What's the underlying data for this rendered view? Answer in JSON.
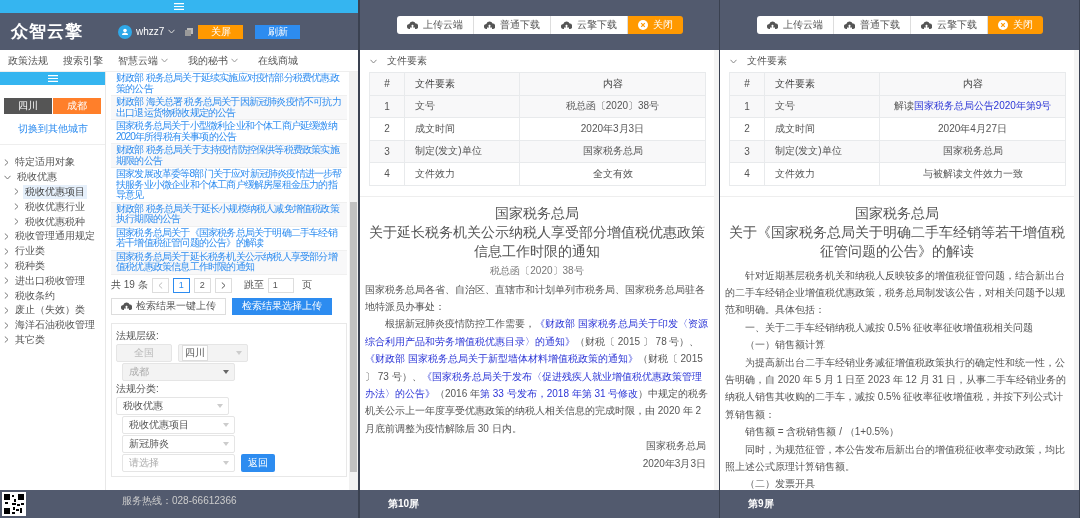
{
  "left": {
    "logo": "众智云擎",
    "user": {
      "name": "whzz7"
    },
    "header_buttons": [
      {
        "label": "关屏",
        "kind": "warning"
      },
      {
        "label": "刷新",
        "kind": "primary"
      }
    ],
    "nav": [
      {
        "label": "政策法规",
        "has_menu": false
      },
      {
        "label": "搜索引擎",
        "has_menu": false
      },
      {
        "label": "智慧云端",
        "has_menu": true
      },
      {
        "label": "我的秘书",
        "has_menu": true
      },
      {
        "label": "在线商城",
        "has_menu": false
      }
    ],
    "regions": [
      {
        "label": "四川",
        "selected": false
      },
      {
        "label": "成都",
        "selected": true
      }
    ],
    "switch_city": "切换到其他城市",
    "tree": [
      {
        "label": "特定适用对象",
        "expanded": false,
        "selected": false
      },
      {
        "label": "税收优惠",
        "expanded": true,
        "selected": false,
        "children": [
          {
            "label": "税收优惠项目",
            "expanded": false,
            "selected": true
          },
          {
            "label": "税收优惠行业",
            "expanded": false,
            "selected": false
          },
          {
            "label": "税收优惠税种",
            "expanded": false,
            "selected": false
          }
        ]
      },
      {
        "label": "税收管理通用规定",
        "expanded": false,
        "selected": false
      },
      {
        "label": "行业类",
        "expanded": false,
        "selected": false
      },
      {
        "label": "税种类",
        "expanded": false,
        "selected": false
      },
      {
        "label": "进出口税收管理",
        "expanded": false,
        "selected": false
      },
      {
        "label": "税收条约",
        "expanded": false,
        "selected": false
      },
      {
        "label": "废止（失效）类",
        "expanded": false,
        "selected": false
      },
      {
        "label": "海洋石油税收管理",
        "expanded": false,
        "selected": false
      },
      {
        "label": "其它类",
        "expanded": false,
        "selected": false
      }
    ],
    "results": [
      "财政部 税务总局关于延续实施应对疫情部分税费优惠政策的公告",
      "财政部 海关总署 税务总局关于因新冠肺炎疫情不可抗力出口退运货物税收规定的公告",
      "国家税务总局关于小型微利企业和个体工商户延缓缴纳2020年所得税有关事项的公告",
      "财政部 税务总局关于支持疫情防控保供等税费政策实施期限的公告",
      "国家发展改革委等8部门关于应对新冠肺炎疫情进一步帮扶服务业小微企业和个体工商户缓解房屋租金压力的指导意见",
      "财政部 税务总局关于延长小规模纳税人减免增值税政策执行期限的公告",
      "国家税务总局关于《国家税务总局关于明确二手车经销若干增值税征管问题的公告》的解读",
      "国家税务总局关于延长税务机关公示纳税人享受部分增值税优惠政策信息工作时限的通知"
    ],
    "pagination": {
      "total": "共 19 条",
      "pages": [
        {
          "label": "1",
          "selected": true
        },
        {
          "label": "2",
          "selected": false
        }
      ],
      "goto_label": "跳至",
      "goto_value": "1",
      "page_unit": "页"
    },
    "upload_buttons": [
      {
        "label": "检索结果一键上传",
        "kind": "default"
      },
      {
        "label": "检索结果选择上传",
        "kind": "primary"
      }
    ],
    "filters": [
      {
        "kind": "label",
        "text": "法规层级:"
      },
      {
        "kind": "row",
        "indent": false,
        "items": [
          {
            "kind": "button",
            "label": "全国",
            "disabled": true
          },
          {
            "kind": "select",
            "value": "四川",
            "tagged": true,
            "disabled": true
          }
        ]
      },
      {
        "kind": "row",
        "indent": true,
        "items": [
          {
            "kind": "select",
            "value": "成都",
            "tagged": false,
            "disabled": true
          }
        ]
      },
      {
        "kind": "label",
        "text": "法规分类:"
      },
      {
        "kind": "row",
        "indent": false,
        "items": [
          {
            "kind": "select",
            "value": "税收优惠",
            "tagged": false,
            "disabled": false
          }
        ]
      },
      {
        "kind": "row",
        "indent": true,
        "items": [
          {
            "kind": "select",
            "value": "税收优惠项目",
            "tagged": false,
            "disabled": false
          }
        ]
      },
      {
        "kind": "row",
        "indent": true,
        "items": [
          {
            "kind": "select",
            "value": "新冠肺炎",
            "tagged": false,
            "disabled": false
          }
        ]
      },
      {
        "kind": "row",
        "indent": true,
        "items": [
          {
            "kind": "select",
            "placeholder": "请选择",
            "tagged": false,
            "disabled": false
          },
          {
            "kind": "button",
            "label": "返回",
            "disabled": false
          }
        ]
      }
    ],
    "footer": {
      "hotline": "服务热线：028-66612366"
    }
  },
  "panels": [
    {
      "toolbar": [
        {
          "label": "上传云端",
          "kind": "cloud"
        },
        {
          "label": "普通下载",
          "kind": "cloud"
        },
        {
          "label": "云擎下载",
          "kind": "cloud"
        },
        {
          "label": "关闭",
          "kind": "close"
        }
      ],
      "section": {
        "title": "文件要素",
        "expanded": true
      },
      "table": {
        "columns": [
          "#",
          "文件要素",
          "内容"
        ],
        "rows": [
          [
            [
              {
                "text": "1",
                "link": false
              }
            ],
            [
              {
                "text": "文号",
                "link": false
              }
            ],
            [
              {
                "text": "税总函〔2020〕38号",
                "link": false
              }
            ]
          ],
          [
            [
              {
                "text": "2",
                "link": false
              }
            ],
            [
              {
                "text": "成文时间",
                "link": false
              }
            ],
            [
              {
                "text": "2020年3月3日",
                "link": false
              }
            ]
          ],
          [
            [
              {
                "text": "3",
                "link": false
              }
            ],
            [
              {
                "text": "制定(发文)单位",
                "link": false
              }
            ],
            [
              {
                "text": "国家税务总局",
                "link": false
              }
            ]
          ],
          [
            [
              {
                "text": "4",
                "link": false
              }
            ],
            [
              {
                "text": "文件效力",
                "link": false
              }
            ],
            [
              {
                "text": "全文有效",
                "link": false
              }
            ]
          ]
        ]
      },
      "title_lines": [
        "国家税务总局",
        "关于延长税务机关公示纳税人享受部分增值税优惠政策信息工作时限的通知"
      ],
      "doc_number": "税总函〔2020〕38号",
      "paragraphs": [
        {
          "kind": "plain",
          "segments": [
            {
              "text": "国家税务总局各省、自治区、直辖市和计划单列市税务局、国家税务总局驻各地特派员办事处：",
              "link": false
            }
          ]
        },
        {
          "kind": "indent",
          "segments": [
            {
              "text": "根据新冠肺炎疫情防控工作需要，",
              "link": false
            },
            {
              "text": "《财政部 国家税务总局关于印发〈资源综合利用产品和劳务增值税优惠目录〉的通知》",
              "link": true
            },
            {
              "text": "（财税〔 2015 〕 78 号）、",
              "link": false
            },
            {
              "text": "《财政部 国家税务总局关于新型墙体材料增值税政策的通知》",
              "link": true
            },
            {
              "text": "（财税〔 2015 〕 73 号）、",
              "link": false
            },
            {
              "text": "《国家税务总局关于发布〈促进残疾人就业增值税优惠政策管理办法〉的公告》",
              "link": true
            },
            {
              "text": "（2016 年",
              "link": false
            },
            {
              "text": "第 33 号发布，2018 年第 31 号修改",
              "link": true
            },
            {
              "text": "）中规定的税务机关公示上一年度享受优惠政策的纳税人相关信息的完成时限，由 2020 年 2 月底前调整为疫情解除后 30 日内。",
              "link": false
            }
          ]
        },
        {
          "kind": "right",
          "segments": [
            {
              "text": "国家税务总局",
              "link": false
            }
          ]
        },
        {
          "kind": "right",
          "segments": [
            {
              "text": "2020年3月3日",
              "link": false
            }
          ]
        }
      ],
      "footer": "第10屏"
    },
    {
      "toolbar": [
        {
          "label": "上传云端",
          "kind": "cloud"
        },
        {
          "label": "普通下载",
          "kind": "cloud"
        },
        {
          "label": "云擎下载",
          "kind": "cloud"
        },
        {
          "label": "关闭",
          "kind": "close"
        }
      ],
      "section": {
        "title": "文件要素",
        "expanded": true
      },
      "table": {
        "columns": [
          "#",
          "文件要素",
          "内容"
        ],
        "rows": [
          [
            [
              {
                "text": "1",
                "link": false
              }
            ],
            [
              {
                "text": "文号",
                "link": false
              }
            ],
            [
              {
                "text": "解读",
                "link": false
              },
              {
                "text": "国家税务总局公告2020年第9号",
                "link": true
              }
            ]
          ],
          [
            [
              {
                "text": "2",
                "link": false
              }
            ],
            [
              {
                "text": "成文时间",
                "link": false
              }
            ],
            [
              {
                "text": "2020年4月27日",
                "link": false
              }
            ]
          ],
          [
            [
              {
                "text": "3",
                "link": false
              }
            ],
            [
              {
                "text": "制定(发文)单位",
                "link": false
              }
            ],
            [
              {
                "text": "国家税务总局",
                "link": false
              }
            ]
          ],
          [
            [
              {
                "text": "4",
                "link": false
              }
            ],
            [
              {
                "text": "文件效力",
                "link": false
              }
            ],
            [
              {
                "text": "与被解读文件效力一致",
                "link": false
              }
            ]
          ]
        ]
      },
      "title_lines": [
        "国家税务总局",
        "关于《国家税务总局关于明确二手车经销等若干增值税征管问题的公告》的解读"
      ],
      "paragraphs": [
        {
          "kind": "indent",
          "segments": [
            {
              "text": "针对近期基层税务机关和纳税人反映较多的增值税征管问题，结合新出台的二手车经销企业增值税优惠政策，税务总局制发该公告，对相关问题予以规范和明确。具体包括：",
              "link": false
            }
          ]
        },
        {
          "kind": "indent",
          "segments": [
            {
              "text": "一、关于二手车经销纳税人减按 0.5% 征收率征收增值税相关问题",
              "link": false
            }
          ]
        },
        {
          "kind": "indent",
          "segments": [
            {
              "text": "（一）销售额计算",
              "link": false
            }
          ]
        },
        {
          "kind": "indent",
          "segments": [
            {
              "text": "为提高新出台二手车经销业务减征增值税政策执行的确定性和统一性，公告明确，自 2020 年 5 月 1 日至 2023 年 12 月 31 日，从事二手车经销业务的纳税人销售其收购的二手车，减按 0.5% 征收率征收增值税，并按下列公式计算销售额：",
              "link": false
            }
          ]
        },
        {
          "kind": "indent",
          "segments": [
            {
              "text": "销售额 = 含税销售额 / （1+0.5%）",
              "link": false
            }
          ]
        },
        {
          "kind": "indent",
          "segments": [
            {
              "text": "同时，为规范征管，本公告发布后新出台的增值税征收率变动政策，均比照上述公式原理计算销售额。",
              "link": false
            }
          ]
        },
        {
          "kind": "indent",
          "segments": [
            {
              "text": "（二）发票开具",
              "link": false
            }
          ]
        }
      ],
      "footer": "第9屏"
    }
  ]
}
